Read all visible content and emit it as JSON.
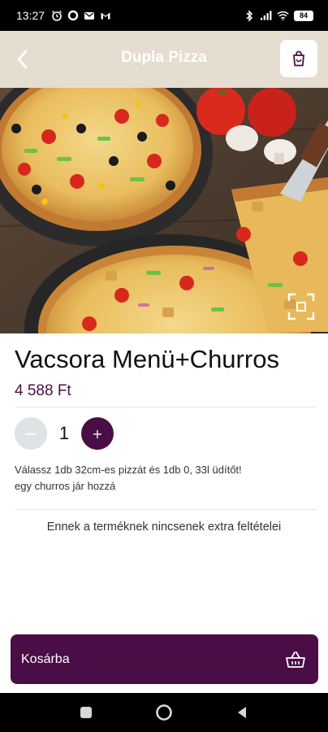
{
  "status_bar": {
    "time": "13:27",
    "battery": "84",
    "left_icons": [
      "alarm-icon",
      "circle-icon",
      "mail-icon",
      "gmail-icon"
    ],
    "right_icons": [
      "bluetooth-icon",
      "signal-icon",
      "wifi-icon",
      "battery-icon"
    ]
  },
  "header": {
    "title": "Dupla Pizza",
    "back_icon": "chevron-left-icon",
    "cart_icon": "shopping-bag-icon",
    "background": "#e4ddd0"
  },
  "hero": {
    "image": "pizza-photo",
    "expand_icon": "fullscreen-icon"
  },
  "product": {
    "name": "Vacsora Menü+Churros",
    "price": "4 588 Ft",
    "quantity": "1",
    "minus_label": "−",
    "plus_label": "+",
    "description_line1": "Válassz 1db 32cm-es pizzát és 1db 0, 33l üdítőt!",
    "description_line2": "egy churros jár hozzá",
    "no_extras": "Ennek a terméknek nincsenek extra feltételei"
  },
  "footer": {
    "add_to_cart": "Kosárba",
    "basket_icon": "basket-icon"
  },
  "colors": {
    "accent": "#4a0d45",
    "minus_bg": "#dfe3e6"
  }
}
